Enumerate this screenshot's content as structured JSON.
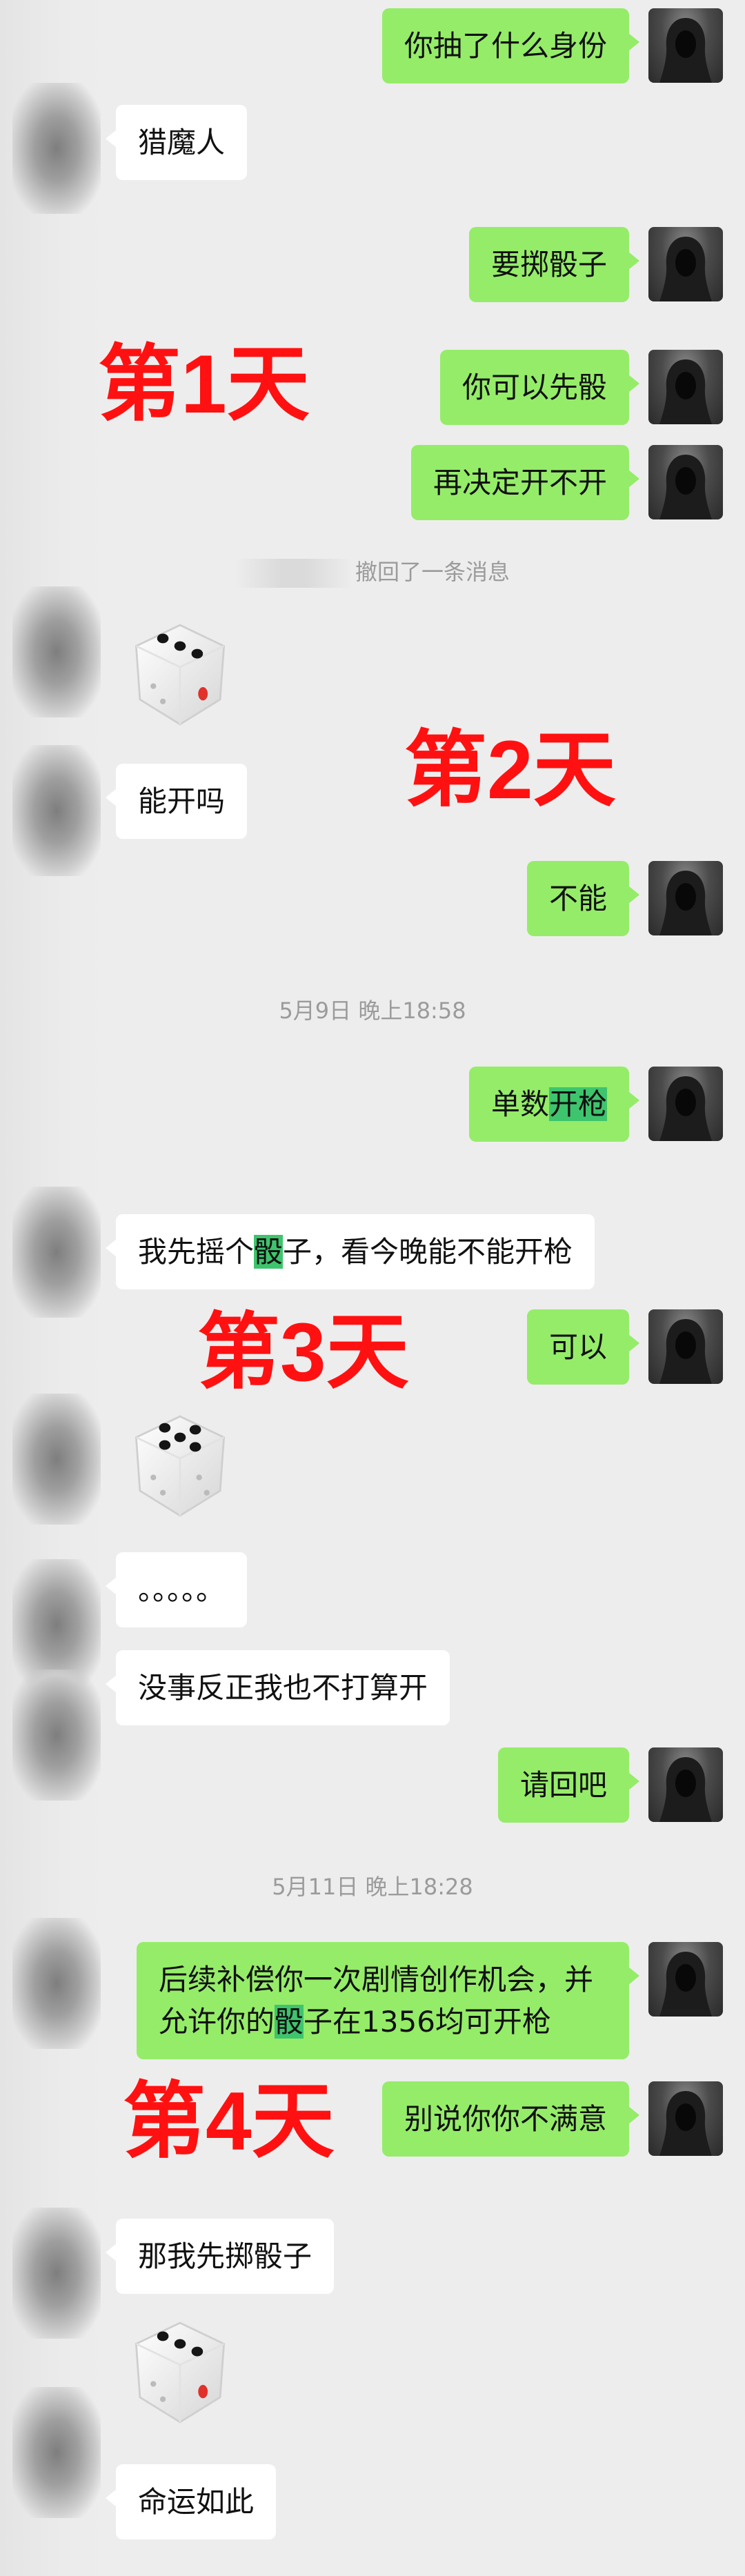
{
  "messages": {
    "m1": "你抽了什么身份",
    "m2": "猎魔人",
    "m3": "要掷骰子",
    "m4": "你可以先骰",
    "m5": "再决定开不开",
    "m6": "能开吗",
    "m7": "不能",
    "m8a": "单数",
    "m8b": "开枪",
    "m9a": "我先摇个",
    "m9b": "骰",
    "m9c": "子，看今晚能不能开枪",
    "m10": "可以",
    "m11": "。。。。。",
    "m12": "没事反正我也不打算开",
    "m13": "请回吧",
    "m14a": "后续补偿你一次剧情创作机会，并允许你的",
    "m14b": "骰",
    "m14c": "子在1356均可开枪",
    "m15": "别说你你不满意",
    "m16": "那我先掷骰子",
    "m17": "命运如此"
  },
  "system": {
    "recalled": "撤回了一条消息",
    "time1": "5月9日 晚上18:58",
    "time2": "5月11日 晚上18:28"
  },
  "annotations": {
    "day1": "第1天",
    "day2": "第2天",
    "day3": "第3天",
    "day4": "第4天"
  },
  "dice_rolls": {
    "roll1": 3,
    "roll2": 5,
    "roll3": 3
  },
  "colors": {
    "outgoing_bubble": "#95ec69",
    "incoming_bubble": "#ffffff",
    "keyword_highlight": "#3ec46d",
    "annotation_text": "#ff1111",
    "background": "#ededed"
  }
}
